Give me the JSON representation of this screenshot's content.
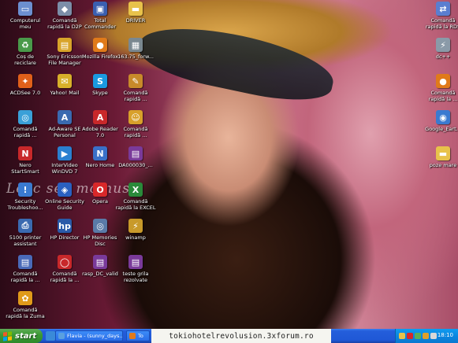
{
  "desktop": {
    "wallpaper_text": "Lecc sec moinus",
    "icons": [
      {
        "label": "Computerul\nmeu",
        "icon": "my-computer-icon",
        "color": "#6c8fd0"
      },
      {
        "label": "Comandă\nrapidă la D2P",
        "icon": "shortcut-d2p-icon",
        "color": "#7c8ea8"
      },
      {
        "label": "Total\nCommander",
        "icon": "floppy-icon",
        "color": "#3a5fb0"
      },
      {
        "label": "DRIVER",
        "icon": "folder-icon",
        "color": "#e8c24a"
      },
      {
        "label": "Comandă\nrapidă la RDS",
        "icon": "network-icon",
        "color": "#5a7ed0"
      },
      {
        "label": "Coș de\nreciclare",
        "icon": "recycle-bin-icon",
        "color": "#4a9a4a"
      },
      {
        "label": "Sony Ericsson\nFile Manager",
        "icon": "file-manager-icon",
        "color": "#d8a42a"
      },
      {
        "label": "Mozilla Firefox",
        "icon": "firefox-icon",
        "color": "#e07a1a"
      },
      {
        "label": "163.75_forw...",
        "icon": "image-file-icon",
        "color": "#7a8890"
      },
      {
        "label": "dc++",
        "icon": "dcpp-icon",
        "color": "#8a9aa8"
      },
      {
        "label": "ACDSee 7.0",
        "icon": "acdsee-icon",
        "color": "#e0601a"
      },
      {
        "label": "Yahoo! Mail",
        "icon": "mail-icon",
        "color": "#d8b02a"
      },
      {
        "label": "Skype",
        "icon": "skype-icon",
        "color": "#1a9ae0"
      },
      {
        "label": "Comandă\nrapidă ...",
        "icon": "shortcut-pen-icon",
        "color": "#c88a2a"
      },
      {
        "label": "Comandă\nrapidă la ...",
        "icon": "firefox-shortcut-icon",
        "color": "#e07a1a"
      },
      {
        "label": "Comandă\nrapidă ...",
        "icon": "shortcut-globe-icon",
        "color": "#3aa0d8"
      },
      {
        "label": "Ad-Aware SE\nPersonal",
        "icon": "ad-aware-icon",
        "color": "#3a6ab0"
      },
      {
        "label": "Adobe Reader\n7.0",
        "icon": "adobe-reader-icon",
        "color": "#c8282a"
      },
      {
        "label": "Comandă\nrapidă ...",
        "icon": "shortcut-smiley-icon",
        "color": "#d8a02a"
      },
      {
        "label": "Google_Eart...",
        "icon": "google-earth-icon",
        "color": "#3a7ad0"
      },
      {
        "label": "Nero\nStartSmart",
        "icon": "nero-icon",
        "color": "#c8282a"
      },
      {
        "label": "InterVideo\nWinDVD 7",
        "icon": "windvd-icon",
        "color": "#2a80d0"
      },
      {
        "label": "Nero Home",
        "icon": "nero-home-icon",
        "color": "#3a70c8"
      },
      {
        "label": "DA000030_...",
        "icon": "winrar-icon",
        "color": "#7a3a9a"
      },
      {
        "label": "poze mare",
        "icon": "folder-icon",
        "color": "#e8c24a"
      },
      {
        "label": "Security\nTroubleshoo...",
        "icon": "security-icon",
        "color": "#3a7ad0"
      },
      {
        "label": "Online Security\nGuide",
        "icon": "shield-icon",
        "color": "#2a60c0"
      },
      {
        "label": "Opera",
        "icon": "opera-icon",
        "color": "#d8282a"
      },
      {
        "label": "Comandă\nrapidă la EXCEL",
        "icon": "excel-icon",
        "color": "#2a8a3a"
      },
      {
        "label": "5100 printer\nassistant",
        "icon": "printer-icon",
        "color": "#3a6ab0"
      },
      {
        "label": "HP Director",
        "icon": "hp-director-icon",
        "color": "#2a5aa8"
      },
      {
        "label": "HP Memories\nDisc",
        "icon": "hp-disc-icon",
        "color": "#5a7aa8"
      },
      {
        "label": "winamp",
        "icon": "winamp-icon",
        "color": "#c89a2a"
      },
      {
        "label": "Comandă\nrapidă la ...",
        "icon": "shortcut-doc-icon",
        "color": "#4a6ab8"
      },
      {
        "label": "Comandă\nrapidă la ...",
        "icon": "shortcut-ring-icon",
        "color": "#c8282a"
      },
      {
        "label": "rasp_DC_valid",
        "icon": "winrar-icon",
        "color": "#7a3a9a"
      },
      {
        "label": "teste grila\nrezolvate",
        "icon": "winrar-icon",
        "color": "#7a3a9a"
      },
      {
        "label": "Comandă\nrapidă la Zuma",
        "icon": "zuma-icon",
        "color": "#e09a1a"
      }
    ]
  },
  "taskbar": {
    "start_label": "start",
    "tasks": [
      {
        "label": "Flavia - (sunny_days...",
        "icon": "chat-icon",
        "color": "#5aa0e0"
      },
      {
        "label": "To",
        "icon": "firefox-icon",
        "color": "#e07a1a"
      }
    ],
    "clock": "18:10"
  },
  "watermark": "tokiohotelrevolusion.3xforum.ro"
}
